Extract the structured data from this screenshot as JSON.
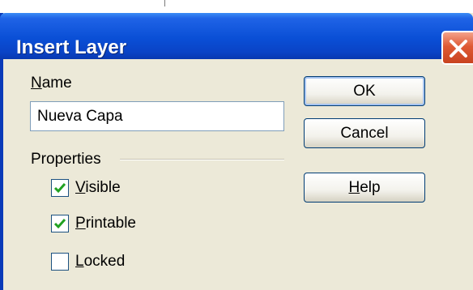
{
  "dialog": {
    "title": "Insert Layer",
    "close_icon": "close-icon",
    "name_label_first": "N",
    "name_label_rest": "ame",
    "name_value": "Nueva Capa",
    "properties_label": "Properties",
    "checkboxes": [
      {
        "mnemonic": "V",
        "rest": "isible",
        "checked": true
      },
      {
        "mnemonic": "P",
        "rest": "rintable",
        "checked": true
      },
      {
        "mnemonic": "L",
        "rest": "ocked",
        "checked": false
      }
    ],
    "buttons": {
      "ok": "OK",
      "cancel": "Cancel",
      "help_first": "H",
      "help_rest": "elp"
    }
  },
  "colors": {
    "titlebar": "#0a4fd6",
    "dialog_bg": "#ece9d8",
    "close_button": "#df5a35"
  }
}
